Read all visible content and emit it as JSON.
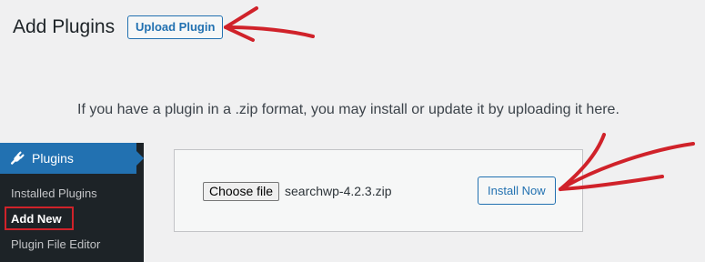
{
  "header": {
    "title": "Add Plugins",
    "upload_button": "Upload Plugin"
  },
  "help_text": "If you have a plugin in a .zip format, you may install or update it by uploading it here.",
  "sidebar": {
    "section_label": "Plugins",
    "section_icon": "plug-icon",
    "items": [
      {
        "label": "Installed Plugins",
        "current": false
      },
      {
        "label": "Add New",
        "current": true
      },
      {
        "label": "Plugin File Editor",
        "current": false
      }
    ]
  },
  "upload_form": {
    "choose_file_label": "Choose file",
    "file_name": "searchwp-4.2.3.zip",
    "install_button": "Install Now"
  },
  "colors": {
    "accent": "#2271b1",
    "annotation": "#d0222a",
    "sidebar_bg": "#1d2327",
    "page_bg": "#f0f0f1"
  }
}
